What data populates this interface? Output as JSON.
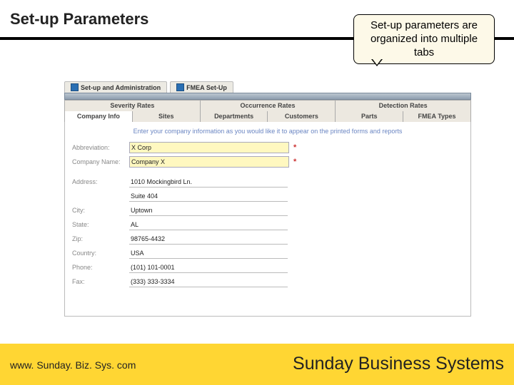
{
  "slide_title": "Set-up Parameters",
  "callout": "Set-up parameters are organized into multiple tabs",
  "nav": {
    "tab1": "Set-up and Administration",
    "tab2": "FMEA Set-Up"
  },
  "tab_row_top": {
    "0": "Severity Rates",
    "1": "Occurrence Rates",
    "2": "Detection Rates"
  },
  "tab_row_bottom": {
    "0": "Company Info",
    "1": "Sites",
    "2": "Departments",
    "3": "Customers",
    "4": "Parts",
    "5": "FMEA Types"
  },
  "form": {
    "hint": "Enter your company information as you would like it to appear on the printed forms and reports",
    "labels": {
      "abbrev": "Abbreviation:",
      "company": "Company Name:",
      "address": "Address:",
      "city": "City:",
      "state": "State:",
      "zip": "Zip:",
      "country": "Country:",
      "phone": "Phone:",
      "fax": "Fax:"
    },
    "values": {
      "abbrev": "X Corp",
      "company": "Company X",
      "address1": "1010 Mockingbird Ln.",
      "address2": "Suite 404",
      "city": "Uptown",
      "state": "AL",
      "zip": "98765-4432",
      "country": "USA",
      "phone": "(101) 101-0001",
      "fax": "(333) 333-3334"
    }
  },
  "footer": {
    "left": "www. Sunday. Biz. Sys. com",
    "right": "Sunday Business Systems"
  }
}
